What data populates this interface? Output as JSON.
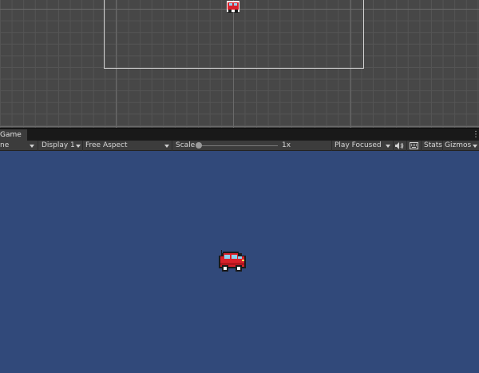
{
  "game_panel": {
    "tab_label": "Game",
    "toolbar": {
      "mode_dropdown": "ne",
      "display_dropdown": "Display 1",
      "aspect_dropdown": "Free Aspect",
      "scale_label": "Scale",
      "scale_value": "1x",
      "play_mode_dropdown": "Play Focused",
      "stats_label": "Stats",
      "gizmos_label": "Gizmos"
    }
  },
  "colors": {
    "scene_background": "#474747",
    "game_background": "#31497a",
    "car_body": "#d9202a",
    "toolbar": "#3c3c3c"
  },
  "icons": [
    "kebab-menu-icon",
    "audio-icon",
    "keyboard-icon",
    "dropdown-caret-icon"
  ]
}
